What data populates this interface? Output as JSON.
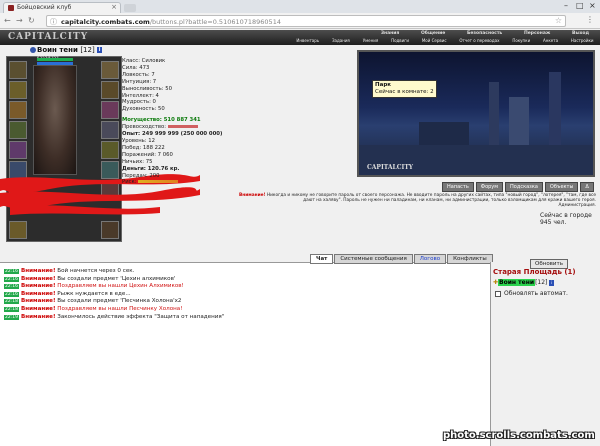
{
  "browser": {
    "tab_title": "Бойцовский клуб",
    "url_host": "capitalcity.combats.com",
    "url_path": "/buttons.pl?battle=0.510610718960514"
  },
  "game": {
    "logo": "CAPITALCITY",
    "top_links": [
      "Знания",
      "Общение",
      "Безопасность",
      "Персонаж",
      "Выход"
    ],
    "sub_links": [
      "Инвентарь",
      "Задания",
      "Умения",
      "Подвиги",
      "Мой Сервис",
      "Отчет о переводах",
      "Покупки",
      "Анкета",
      "Настройки"
    ]
  },
  "character": {
    "name": "Воин тени",
    "level": "[12]",
    "hp": "5727/5727",
    "mp": "1511/1512",
    "stats": [
      "Класс: Силовик",
      "Сила: 473",
      "Ловкость: 7",
      "Интуиция: 7",
      "Выносливость: 50",
      "Интеллект: 4",
      "Мудрость: 0",
      "Духовность: 50"
    ],
    "power": "Могущество: 510 887 341",
    "superiority": "Превосходство:",
    "exp": "Опыт: 249 999 999 (250 000 000)",
    "level_line": "Уровень: 12",
    "wins": "Побед: 188 222",
    "losses": "Поражений: 7 060",
    "draws": "Ничьих: 75",
    "money": "Деньги: 120.76 кр.",
    "transfers": "Передач: 200",
    "risk": "Риск:"
  },
  "location": {
    "tooltip_title": "Парк",
    "tooltip_sub": "Сейчас в комнате: 2",
    "logo": "CAPITALCITY",
    "buttons": [
      "Напасть",
      "Форум",
      "Подсказка",
      "Объекты",
      "Δ"
    ],
    "warning_title": "Внимание!",
    "warning_text": "Никогда и никому не говорите пароль от своего персонажа. Не вводите пароль на других сайтах, типа \"новый город\", \"лотерея\", \"там, где все дают на халяву\". Пароль не нужен ни паладинам, ни кланам, ни администрации, только взломщикам для кражи вашего героя.",
    "warning_sign": "Администрация.",
    "in_city": "Сейчас в городе 945 чел."
  },
  "chat": {
    "tabs": [
      "Чат",
      "Системные сообщения",
      "Логово",
      "Конфликты"
    ],
    "lines": [
      {
        "time": "22:16",
        "text": "Бой начнется через 0 сек.",
        "color": "normal"
      },
      {
        "time": "22:16",
        "text": "Вы создали предмет 'Цехин алхимиков'",
        "color": "normal"
      },
      {
        "time": "22:16",
        "text": "Поздравляем вы нашли Цехин Алхимиков!",
        "color": "red"
      },
      {
        "time": "22:16",
        "text": "Рыжк нуждается в еде...",
        "color": "normal"
      },
      {
        "time": "22:18",
        "text": "Вы создали предмет 'Песчинка Холона'x2",
        "color": "normal"
      },
      {
        "time": "22:18",
        "text": "Поздравляем вы нашли Песчинку Холона!",
        "color": "red"
      },
      {
        "time": "22:19",
        "text": "Закончилось действие эффекта \"Защита от нападения\"",
        "color": "normal"
      }
    ],
    "warning_word": "Внимание!"
  },
  "room": {
    "refresh": "Обновить",
    "name": "Старая Площадь (1)",
    "online_nick": "Воин тени",
    "online_level": "[12]",
    "auto_update": "Обновлять автомат."
  },
  "watermark": "photo.scrolls.combats.com"
}
